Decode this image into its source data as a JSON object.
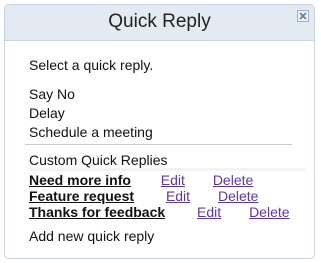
{
  "header": {
    "title": "Quick Reply",
    "close_icon": "close-icon"
  },
  "instruction": "Select a quick reply.",
  "default_replies": [
    "Say No",
    "Delay",
    "Schedule a meeting"
  ],
  "custom": {
    "heading": "Custom Quick Replies",
    "items": [
      {
        "name": "Need more info",
        "edit": "Edit",
        "delete": "Delete"
      },
      {
        "name": "Feature request",
        "edit": "Edit",
        "delete": "Delete"
      },
      {
        "name": "Thanks for feedback",
        "edit": "Edit",
        "delete": "Delete"
      }
    ]
  },
  "add_new": "Add new quick reply",
  "colors": {
    "header_bg": "#e4eaf1",
    "border": "#c9d3df",
    "link": "#5b3a9a"
  }
}
